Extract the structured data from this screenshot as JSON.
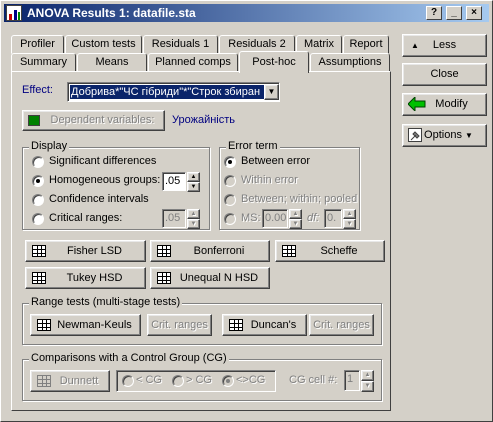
{
  "window": {
    "title": "ANOVA Results 1: datafile.sta",
    "help_btn": "?",
    "min_btn": "_",
    "close_btn": "×"
  },
  "tabs_row1": [
    "Profiler",
    "Custom tests",
    "Residuals 1",
    "Residuals 2",
    "Matrix",
    "Report"
  ],
  "tabs_row2": [
    "Summary",
    "Means",
    "Planned comps",
    "Post-hoc",
    "Assumptions"
  ],
  "active_tab": "Post-hoc",
  "effect": {
    "label": "Effect:",
    "value": "Добрива*\"ЧС гібриди\"*\"Строк збиран"
  },
  "dependent": {
    "button": "Dependent variables:",
    "value": "Урожайність"
  },
  "display": {
    "title": "Display",
    "options": [
      "Significant differences",
      "Homogeneous groups:",
      "Confidence intervals",
      "Critical ranges:"
    ],
    "selected": "Homogeneous groups:",
    "homogeneous_value": ".05",
    "critical_value": ".05"
  },
  "error_term": {
    "title": "Error term",
    "options": [
      "Between error",
      "Within error",
      "Between; within; pooled",
      "MS:"
    ],
    "selected": "Between error",
    "ms_value": "0.00",
    "df_label": "df:",
    "df_value": "0."
  },
  "tests": {
    "fisher": "Fisher LSD",
    "bonferroni": "Bonferroni",
    "scheffe": "Scheffe",
    "tukey": "Tukey HSD",
    "unequal": "Unequal N HSD"
  },
  "range_tests": {
    "title": "Range tests (multi-stage tests)",
    "newman": "Newman-Keuls",
    "crit1": "Crit. ranges",
    "duncan": "Duncan's",
    "crit2": "Crit. ranges"
  },
  "control_group": {
    "title": "Comparisons with a Control Group (CG)",
    "dunnett": "Dunnett",
    "options": [
      "< CG",
      "> CG",
      "<>CG"
    ],
    "selected": "<>CG",
    "cell_label": "CG cell #:",
    "cell_value": "1"
  },
  "side_buttons": {
    "less": "Less",
    "close": "Close",
    "modify": "Modify",
    "options": "Options"
  },
  "colors": {
    "title_start": "#0a246a",
    "title_end": "#a6caf0",
    "face": "#d4d0c8",
    "accent_green": "#00a000",
    "link_blue": "#000080"
  }
}
